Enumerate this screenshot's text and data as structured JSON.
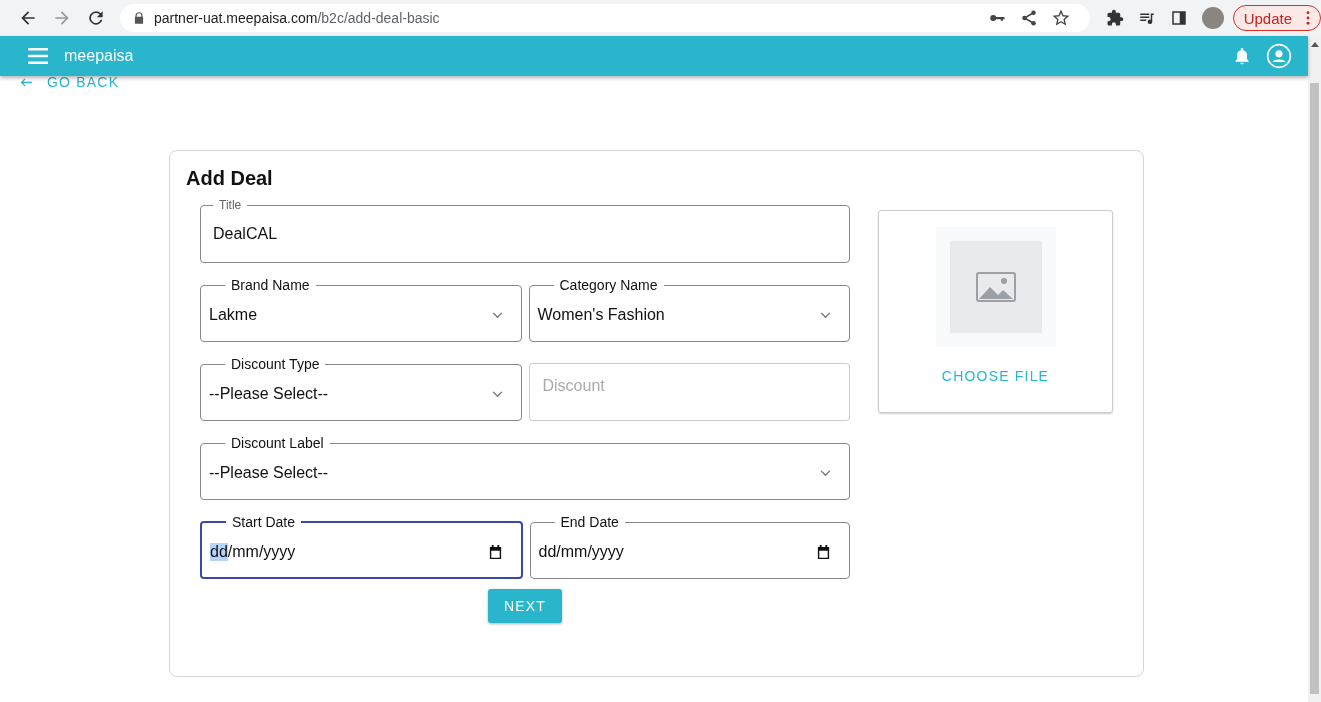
{
  "browser": {
    "url_host": "partner-uat.meepaisa.com",
    "url_path": "/b2c/add-deal-basic",
    "update_label": "Update"
  },
  "app": {
    "brand": "meepaisa"
  },
  "go_back": "GO BACK",
  "form": {
    "title": "Add Deal",
    "rows": [
      {
        "fields": [
          {
            "kind": "text",
            "label": "Title",
            "value": "DealCAL",
            "focused": false
          }
        ]
      },
      {
        "fields": [
          {
            "kind": "select",
            "label": "Brand Name",
            "value": "Lakme",
            "focused": false
          },
          {
            "kind": "select",
            "label": "Category Name",
            "value": "Women's Fashion",
            "focused": false
          }
        ]
      },
      {
        "fields": [
          {
            "kind": "select",
            "label": "Discount Type",
            "value": "--Please Select--",
            "focused": false
          },
          {
            "kind": "text",
            "placeholder": "Discount",
            "focused": false
          }
        ]
      },
      {
        "fields": [
          {
            "kind": "select",
            "label": "Discount Label",
            "value": "--Please Select--",
            "focused": false
          }
        ]
      },
      {
        "fields": [
          {
            "kind": "date",
            "label": "Start Date",
            "value": "dd/mm/yyyy",
            "focused": true
          },
          {
            "kind": "date",
            "label": "End Date",
            "value": "dd/mm/yyyy",
            "focused": false
          }
        ]
      }
    ],
    "choose_file": "CHOOSE FILE",
    "next": "NEXT"
  }
}
